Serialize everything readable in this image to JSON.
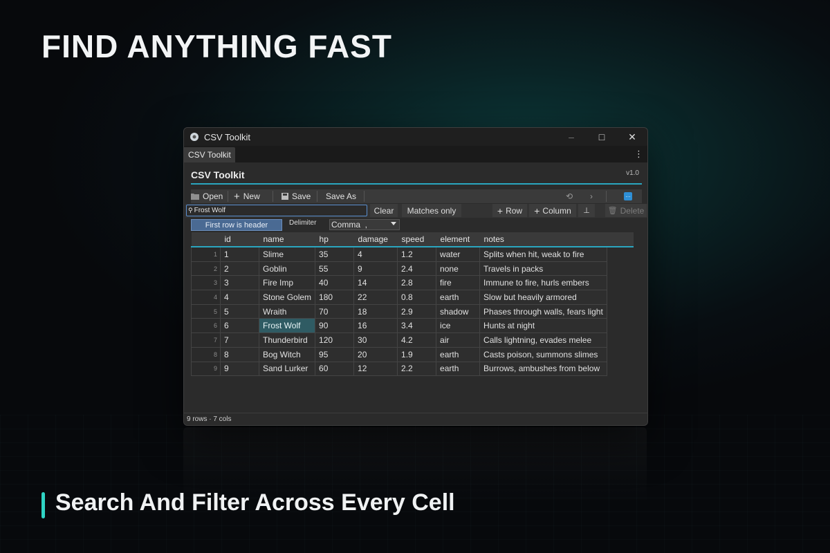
{
  "marketing": {
    "headline": "FIND ANYTHING FAST",
    "caption": "Search And Filter Across Every Cell"
  },
  "window": {
    "title": "CSV Toolkit",
    "controls": {
      "minimize": "–",
      "maximize": "□",
      "close": "✕"
    },
    "tab_label": "CSV Toolkit",
    "app_title": "CSV Toolkit",
    "version": "v1.0"
  },
  "toolbar": {
    "open": "Open",
    "new": "New",
    "save": "Save",
    "save_as": "Save As"
  },
  "search": {
    "value": "Frost Wolf",
    "clear": "Clear",
    "matches_only": "Matches only",
    "add_row": "Row",
    "add_column": "Column",
    "delete": "Delete"
  },
  "options": {
    "first_row_header": "First row is header",
    "delimiter_label": "Delimiter",
    "delimiter_value": "Comma  ,"
  },
  "table": {
    "columns": [
      "id",
      "name",
      "hp",
      "damage",
      "speed",
      "element",
      "notes"
    ],
    "rows": [
      {
        "n": "1",
        "cells": [
          "1",
          "Slime",
          "35",
          "4",
          "1.2",
          "water",
          "Splits when hit, weak to fire"
        ]
      },
      {
        "n": "2",
        "cells": [
          "2",
          "Goblin",
          "55",
          "9",
          "2.4",
          "none",
          "Travels in packs"
        ]
      },
      {
        "n": "3",
        "cells": [
          "3",
          "Fire Imp",
          "40",
          "14",
          "2.8",
          "fire",
          "Immune to fire, hurls embers"
        ]
      },
      {
        "n": "4",
        "cells": [
          "4",
          "Stone Golem",
          "180",
          "22",
          "0.8",
          "earth",
          "Slow but heavily armored"
        ]
      },
      {
        "n": "5",
        "cells": [
          "5",
          "Wraith",
          "70",
          "18",
          "2.9",
          "shadow",
          "Phases through walls, fears light"
        ]
      },
      {
        "n": "6",
        "cells": [
          "6",
          "Frost Wolf",
          "90",
          "16",
          "3.4",
          "ice",
          "Hunts at night"
        ]
      },
      {
        "n": "7",
        "cells": [
          "7",
          "Thunderbird",
          "120",
          "30",
          "4.2",
          "air",
          "Calls lightning, evades melee"
        ]
      },
      {
        "n": "8",
        "cells": [
          "8",
          "Bog Witch",
          "95",
          "20",
          "1.9",
          "earth",
          "Casts poison, summons slimes"
        ]
      },
      {
        "n": "9",
        "cells": [
          "9",
          "Sand Lurker",
          "60",
          "12",
          "2.2",
          "earth",
          "Burrows, ambushes from below"
        ]
      }
    ]
  },
  "status": "9 rows · 7 cols",
  "colors": {
    "accent": "#2aa6c0",
    "caption_bar": "#2fd4c4",
    "match_highlight": "#2f5b63"
  }
}
